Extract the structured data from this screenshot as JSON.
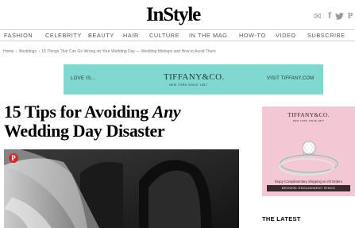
{
  "header": {
    "logo": "InStyle",
    "social": [
      {
        "name": "mail-icon",
        "glyph": "✉"
      },
      {
        "name": "facebook-icon",
        "glyph": "f"
      },
      {
        "name": "twitter-icon",
        "glyph": "🐦"
      },
      {
        "name": "pinterest-icon",
        "glyph": "P"
      }
    ]
  },
  "nav": {
    "items": [
      "FASHION",
      "CELEBRITY",
      "BEAUTY",
      "HAIR",
      "CULTURE",
      "IN THE MAG",
      "HOW-TO",
      "VIDEO",
      "SUBSCRIBE"
    ]
  },
  "breadcrumb": {
    "items": [
      "Home",
      "Weddings",
      "15 Things That Can Go Wrong on Your Wedding Day — Wedding Mishaps and How to Avoid Them"
    ],
    "separator": "›"
  },
  "ad_banner": {
    "love": "LOVE IS...",
    "brand": "TIFFANY&CO.",
    "since": "NEW YORK SINCE 1837",
    "visit": "VISIT TIFFANY.COM",
    "color": "#81d8d0"
  },
  "article": {
    "headline_pre": "15 Tips for Avoiding ",
    "headline_em": "Any",
    "headline_line2": "Wedding Day Disaster",
    "pin_glyph": "P"
  },
  "side_ad": {
    "brand": "TIFFANY&CO.",
    "since": "NEW YORK SINCE 1837",
    "shipping": "Enjoy Complimentary Shipping on All Orders",
    "cta": "BROWSE ENGAGEMENT RINGS",
    "color": "#f3c8d4"
  },
  "sidebar": {
    "latest_heading": "THE LATEST"
  }
}
